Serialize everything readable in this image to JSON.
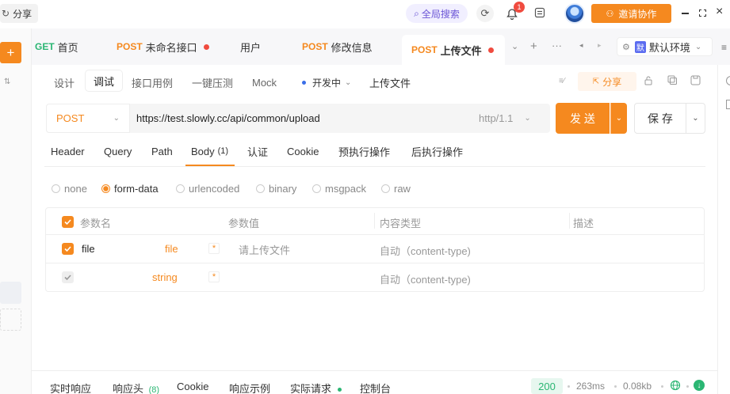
{
  "header": {
    "share_label": "分享",
    "search_label": "全局搜索",
    "notif_count": "1",
    "invite_label": "邀请协作"
  },
  "tabs": [
    {
      "method": "GET",
      "label": "首页"
    },
    {
      "method": "POST",
      "label": "未命名接口"
    },
    {
      "method": "",
      "label": "用户"
    },
    {
      "method": "POST",
      "label": "修改信息"
    },
    {
      "method": "POST",
      "label": "上传文件"
    }
  ],
  "env": {
    "badge": "默",
    "label": "默认环境"
  },
  "subtabs": {
    "design": "设计",
    "debug": "调试",
    "cases": "接口用例",
    "stress": "一键压测",
    "mock": "Mock",
    "status": "开发中",
    "api_name": "上传文件",
    "share": "分享"
  },
  "request": {
    "method": "POST",
    "url": "https://test.slowly.cc/api/common/upload",
    "protocol": "http/1.1",
    "send": "发 送",
    "save": "保 存"
  },
  "param_tabs": {
    "header": "Header",
    "query": "Query",
    "path": "Path",
    "body": "Body",
    "body_count": "(1)",
    "auth": "认证",
    "cookie": "Cookie",
    "pre": "预执行操作",
    "post": "后执行操作"
  },
  "body_types": [
    "none",
    "form-data",
    "urlencoded",
    "binary",
    "msgpack",
    "raw"
  ],
  "table": {
    "headers": {
      "name": "参数名",
      "value": "参数值",
      "content_type": "内容类型",
      "desc": "描述"
    },
    "rows": [
      {
        "name": "file",
        "type": "file",
        "required": "*",
        "value_placeholder": "请上传文件",
        "content_type": "自动（content-type)"
      },
      {
        "name": "",
        "type": "string",
        "required": "*",
        "value_placeholder": "",
        "content_type": "自动（content-type)"
      }
    ]
  },
  "response": {
    "live": "实时响应",
    "headers": "响应头",
    "headers_count": "(8)",
    "cookie": "Cookie",
    "example": "响应示例",
    "actual": "实际请求",
    "console": "控制台",
    "status": "200",
    "time": "263ms",
    "size": "0.08kb"
  }
}
